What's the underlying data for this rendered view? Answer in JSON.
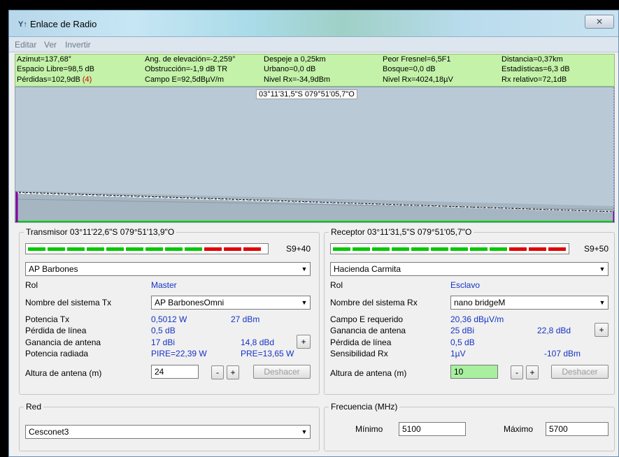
{
  "window": {
    "title": "Enlace de Radio",
    "icon": "radio-link-icon",
    "close_label": "✕"
  },
  "menu": [
    "Editar",
    "Ver",
    "Invertir"
  ],
  "stats": {
    "row1": {
      "azimut": "Azimut=137,68°",
      "elevacion": "Ang. de elevación=-2,259°",
      "despeje": "Despeje a 0,25km",
      "fresnel": "Peor Fresnel=6,5F1",
      "distancia": "Distancia=0,37km"
    },
    "row2": {
      "espacio": "Espacio Libre=98,5 dB",
      "obstruccion": "Obstrucción=-1,9 dB TR",
      "urbano": "Urbano=0,0 dB",
      "bosque": "Bosque=0,0 dB",
      "estadisticas": "Estadísticas=6,3 dB"
    },
    "row3": {
      "perdidas": "Pérdidas=102,9dB",
      "perdidas_flag": "(4)",
      "campo": "Campo E=92,5dBµV/m",
      "nivel_dbm": "Nivel Rx=-34,9dBm",
      "nivel_uv": "Nivel Rx=4024,18µV",
      "rx_relativo": "Rx relativo=72,1dB"
    }
  },
  "profile": {
    "coord_label": "03°11'31,5\"S 079°51'05,7\"O"
  },
  "transmisor": {
    "legend": "Transmisor 03°11'22,6\"S 079°51'13,9\"O",
    "signal_text": "S9+40",
    "signal_segments": {
      "green": 9,
      "red": 3
    },
    "site": "AP Barbones",
    "rol_label": "Rol",
    "rol_value": "Master",
    "sistema_label": "Nombre del sistema Tx",
    "sistema_value": "AP BarbonesOmni",
    "potencia_label": "Potencia Tx",
    "potencia_w": "0,5012 W",
    "potencia_dbm": "27 dBm",
    "perdida_label": "Pérdida de línea",
    "perdida_value": "0,5 dB",
    "ganancia_label": "Ganancia de antena",
    "ganancia_dbi": "17 dBi",
    "ganancia_dbd": "14,8 dBd",
    "radiada_label": "Potencia radiada",
    "pire": "PIRE=22,39 W",
    "pre": "PRE=13,65 W",
    "altura_label": "Altura de antena (m)",
    "altura_value": "24",
    "deshacer": "Deshacer"
  },
  "receptor": {
    "legend": "Receptor 03°11'31,5\"S 079°51'05,7\"O",
    "signal_text": "S9+50",
    "signal_segments": {
      "green": 9,
      "red": 3
    },
    "site": "Hacienda Carmita",
    "rol_label": "Rol",
    "rol_value": "Esclavo",
    "sistema_label": "Nombre del sistema Rx",
    "sistema_value": "nano bridgeM",
    "campo_label": "Campo E requerido",
    "campo_value": "20,36 dBµV/m",
    "ganancia_label": "Ganancia de antena",
    "ganancia_dbi": "25 dBi",
    "ganancia_dbd": "22,8 dBd",
    "perdida_label": "Pérdida de línea",
    "perdida_value": "0,5 dB",
    "sensibilidad_label": "Sensibilidad Rx",
    "sensibilidad_uv": "1µV",
    "sensibilidad_dbm": "-107 dBm",
    "altura_label": "Altura de antena (m)",
    "altura_value": "10",
    "deshacer": "Deshacer"
  },
  "red": {
    "legend": "Red",
    "value": "Cesconet3"
  },
  "frecuencia": {
    "legend": "Frecuencia (MHz)",
    "min_label": "Mínimo",
    "min_value": "5100",
    "max_label": "Máximo",
    "max_value": "5700"
  },
  "buttons": {
    "minus": "-",
    "plus": "+"
  },
  "colors": {
    "stats_bg": "#c3f2a8",
    "value_blue": "#1533c4",
    "signal_green": "#00c800",
    "signal_red": "#e00000"
  }
}
